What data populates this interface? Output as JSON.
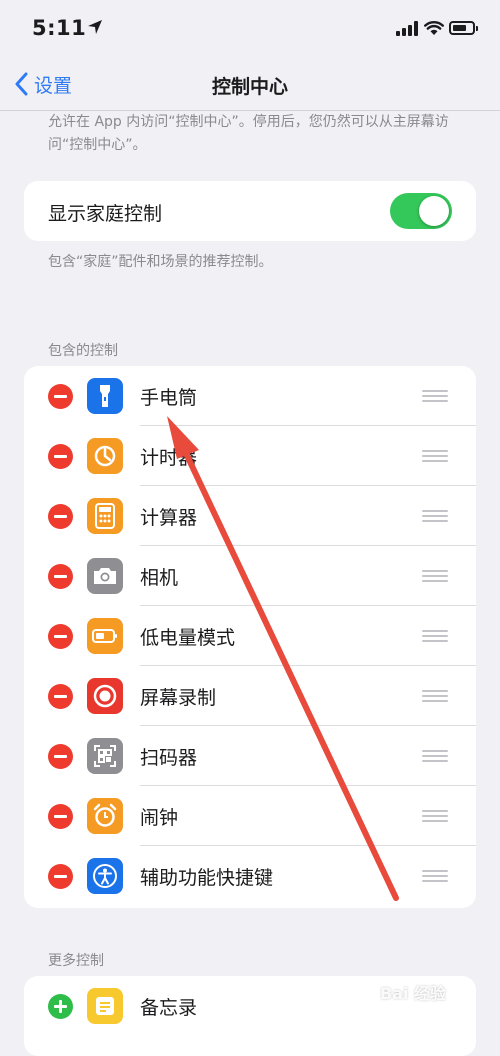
{
  "status": {
    "time": "5:11"
  },
  "nav": {
    "back_label": "设置",
    "title": "控制中心"
  },
  "intro_text": "允许在 App 内访问“控制中心”。停用后，您仍然可以从主屏幕访问“控制中心”。",
  "home_control": {
    "label": "显示家庭控制",
    "enabled": true,
    "description": "包含“家庭”配件和场景的推荐控制。"
  },
  "included_header": "包含的控制",
  "included_controls": [
    {
      "label": "手电筒",
      "icon": "flashlight-icon",
      "color": "#1a73e8"
    },
    {
      "label": "计时器",
      "icon": "timer-icon",
      "color": "#f59a23"
    },
    {
      "label": "计算器",
      "icon": "calculator-icon",
      "color": "#f59a23"
    },
    {
      "label": "相机",
      "icon": "camera-icon",
      "color": "#8e8e93"
    },
    {
      "label": "低电量模式",
      "icon": "battery-icon",
      "color": "#f59a23"
    },
    {
      "label": "屏幕录制",
      "icon": "screen-record-icon",
      "color": "#e8382d"
    },
    {
      "label": "扫码器",
      "icon": "qr-scanner-icon",
      "color": "#8e8e93"
    },
    {
      "label": "闹钟",
      "icon": "alarm-icon",
      "color": "#f59a23"
    },
    {
      "label": "辅助功能快捷键",
      "icon": "accessibility-icon",
      "color": "#1a73e8"
    }
  ],
  "more_header": "更多控制",
  "more_controls": [
    {
      "label": "备忘录",
      "icon": "notes-icon",
      "color": "#f7c92f"
    }
  ],
  "watermark": "Bai 经验"
}
